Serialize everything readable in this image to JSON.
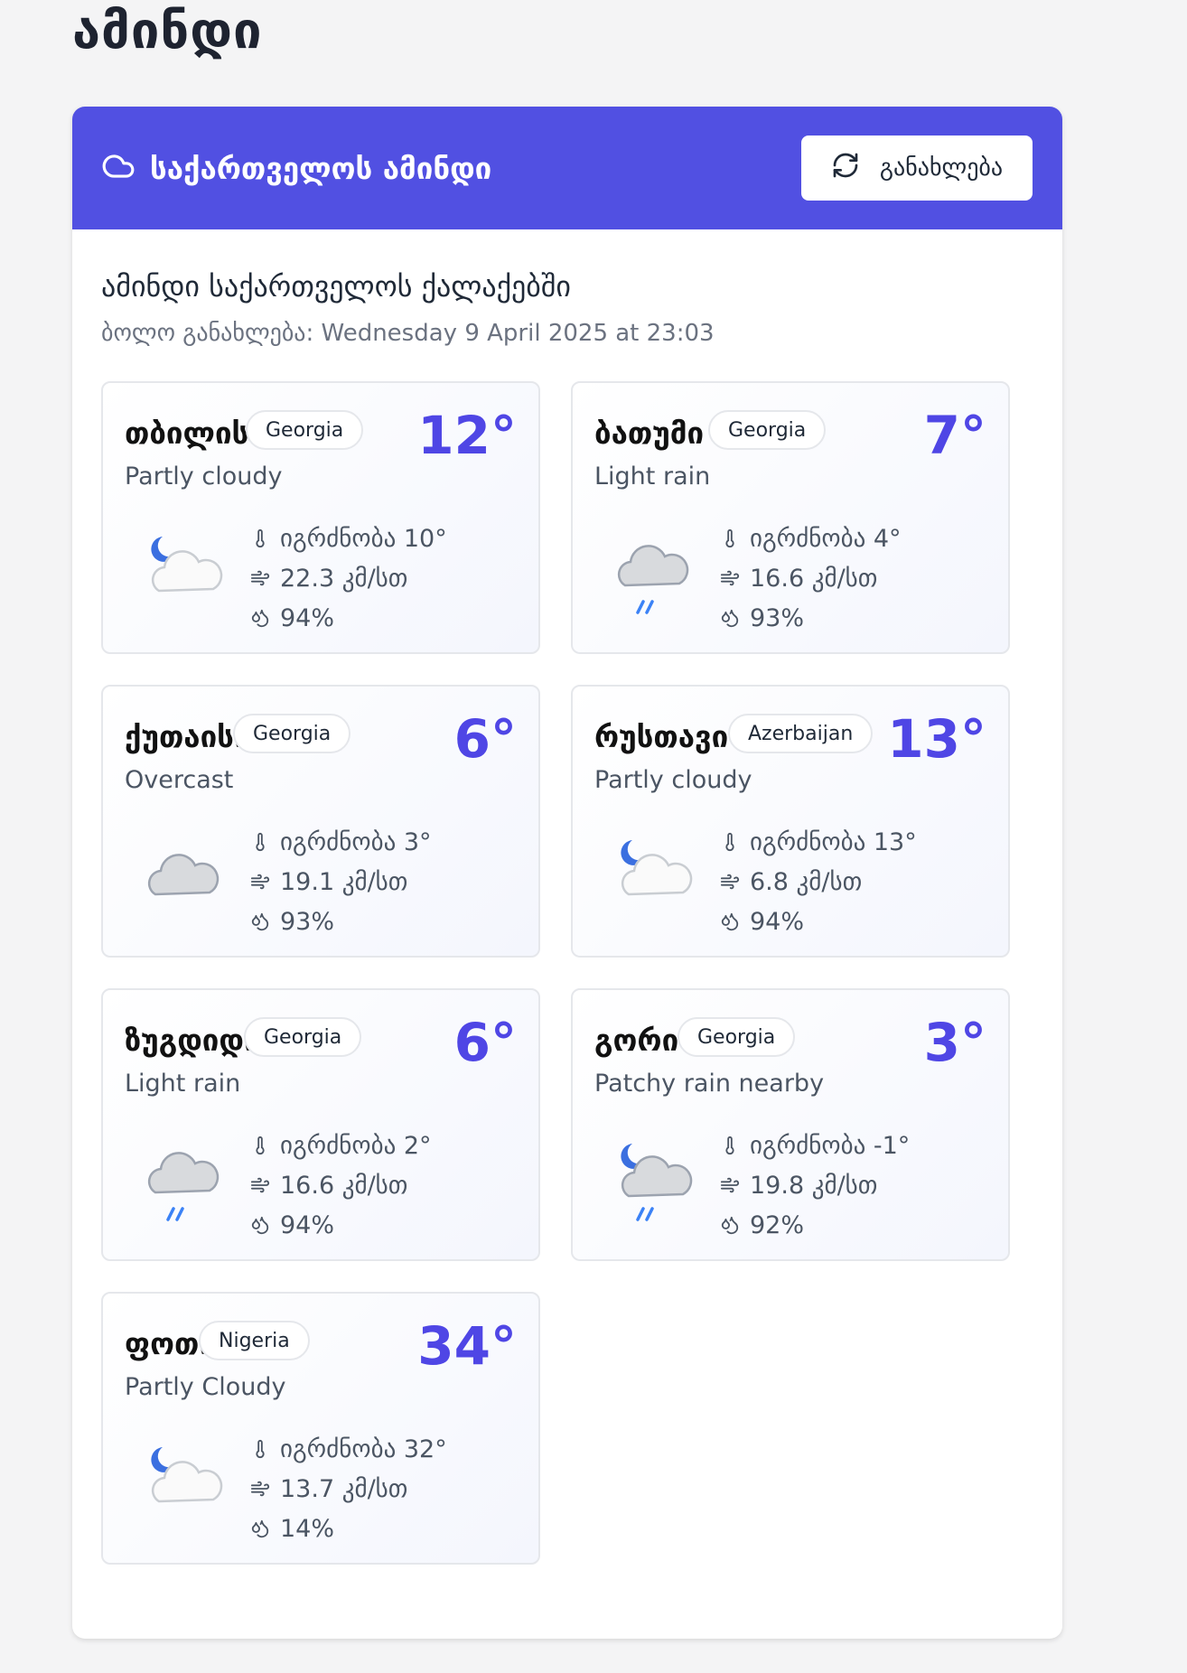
{
  "page": {
    "title": "ამინდი"
  },
  "header": {
    "title": "საქართველოს ამინდი",
    "refresh_label": "განახლება"
  },
  "section": {
    "subtitle": "ამინდი საქართველოს ქალაქებში",
    "last_update": "ბოლო განახლება: Wednesday 9 April 2025 at 23:03"
  },
  "colors": {
    "header_bg": "#5150e2",
    "temp": "#4f46e5",
    "rain": "#3b82f6",
    "moon": "#3b6fe0"
  },
  "cities": [
    {
      "name": "თბილისი",
      "country": "Georgia",
      "temp": "12°",
      "condition": "Partly cloudy",
      "feels": "იგრძნობა 10°",
      "wind": "22.3 კმ/სთ",
      "humidity": "94%",
      "icon": "moon-cloud-icon"
    },
    {
      "name": "ბათუმი",
      "country": "Georgia",
      "temp": "7°",
      "condition": "Light rain",
      "feels": "იგრძნობა 4°",
      "wind": "16.6 კმ/სთ",
      "humidity": "93%",
      "icon": "rain-cloud-icon"
    },
    {
      "name": "ქუთაისი",
      "country": "Georgia",
      "temp": "6°",
      "condition": "Overcast",
      "feels": "იგრძნობა 3°",
      "wind": "19.1 კმ/სთ",
      "humidity": "93%",
      "icon": "overcast-cloud-icon"
    },
    {
      "name": "რუსთავი",
      "country": "Azerbaijan",
      "temp": "13°",
      "condition": "Partly cloudy",
      "feels": "იგრძნობა 13°",
      "wind": "6.8 კმ/სთ",
      "humidity": "94%",
      "icon": "moon-cloud-icon"
    },
    {
      "name": "ზუგდიდი",
      "country": "Georgia",
      "temp": "6°",
      "condition": "Light rain",
      "feels": "იგრძნობა 2°",
      "wind": "16.6 კმ/სთ",
      "humidity": "94%",
      "icon": "rain-cloud-icon"
    },
    {
      "name": "გორი",
      "country": "Georgia",
      "temp": "3°",
      "condition": "Patchy rain nearby",
      "feels": "იგრძნობა -1°",
      "wind": "19.8 კმ/სთ",
      "humidity": "92%",
      "icon": "moon-rain-cloud-icon"
    },
    {
      "name": "ფოთი",
      "country": "Nigeria",
      "temp": "34°",
      "condition": "Partly Cloudy",
      "feels": "იგრძნობა 32°",
      "wind": "13.7 კმ/სთ",
      "humidity": "14%",
      "icon": "moon-cloud-icon"
    }
  ]
}
